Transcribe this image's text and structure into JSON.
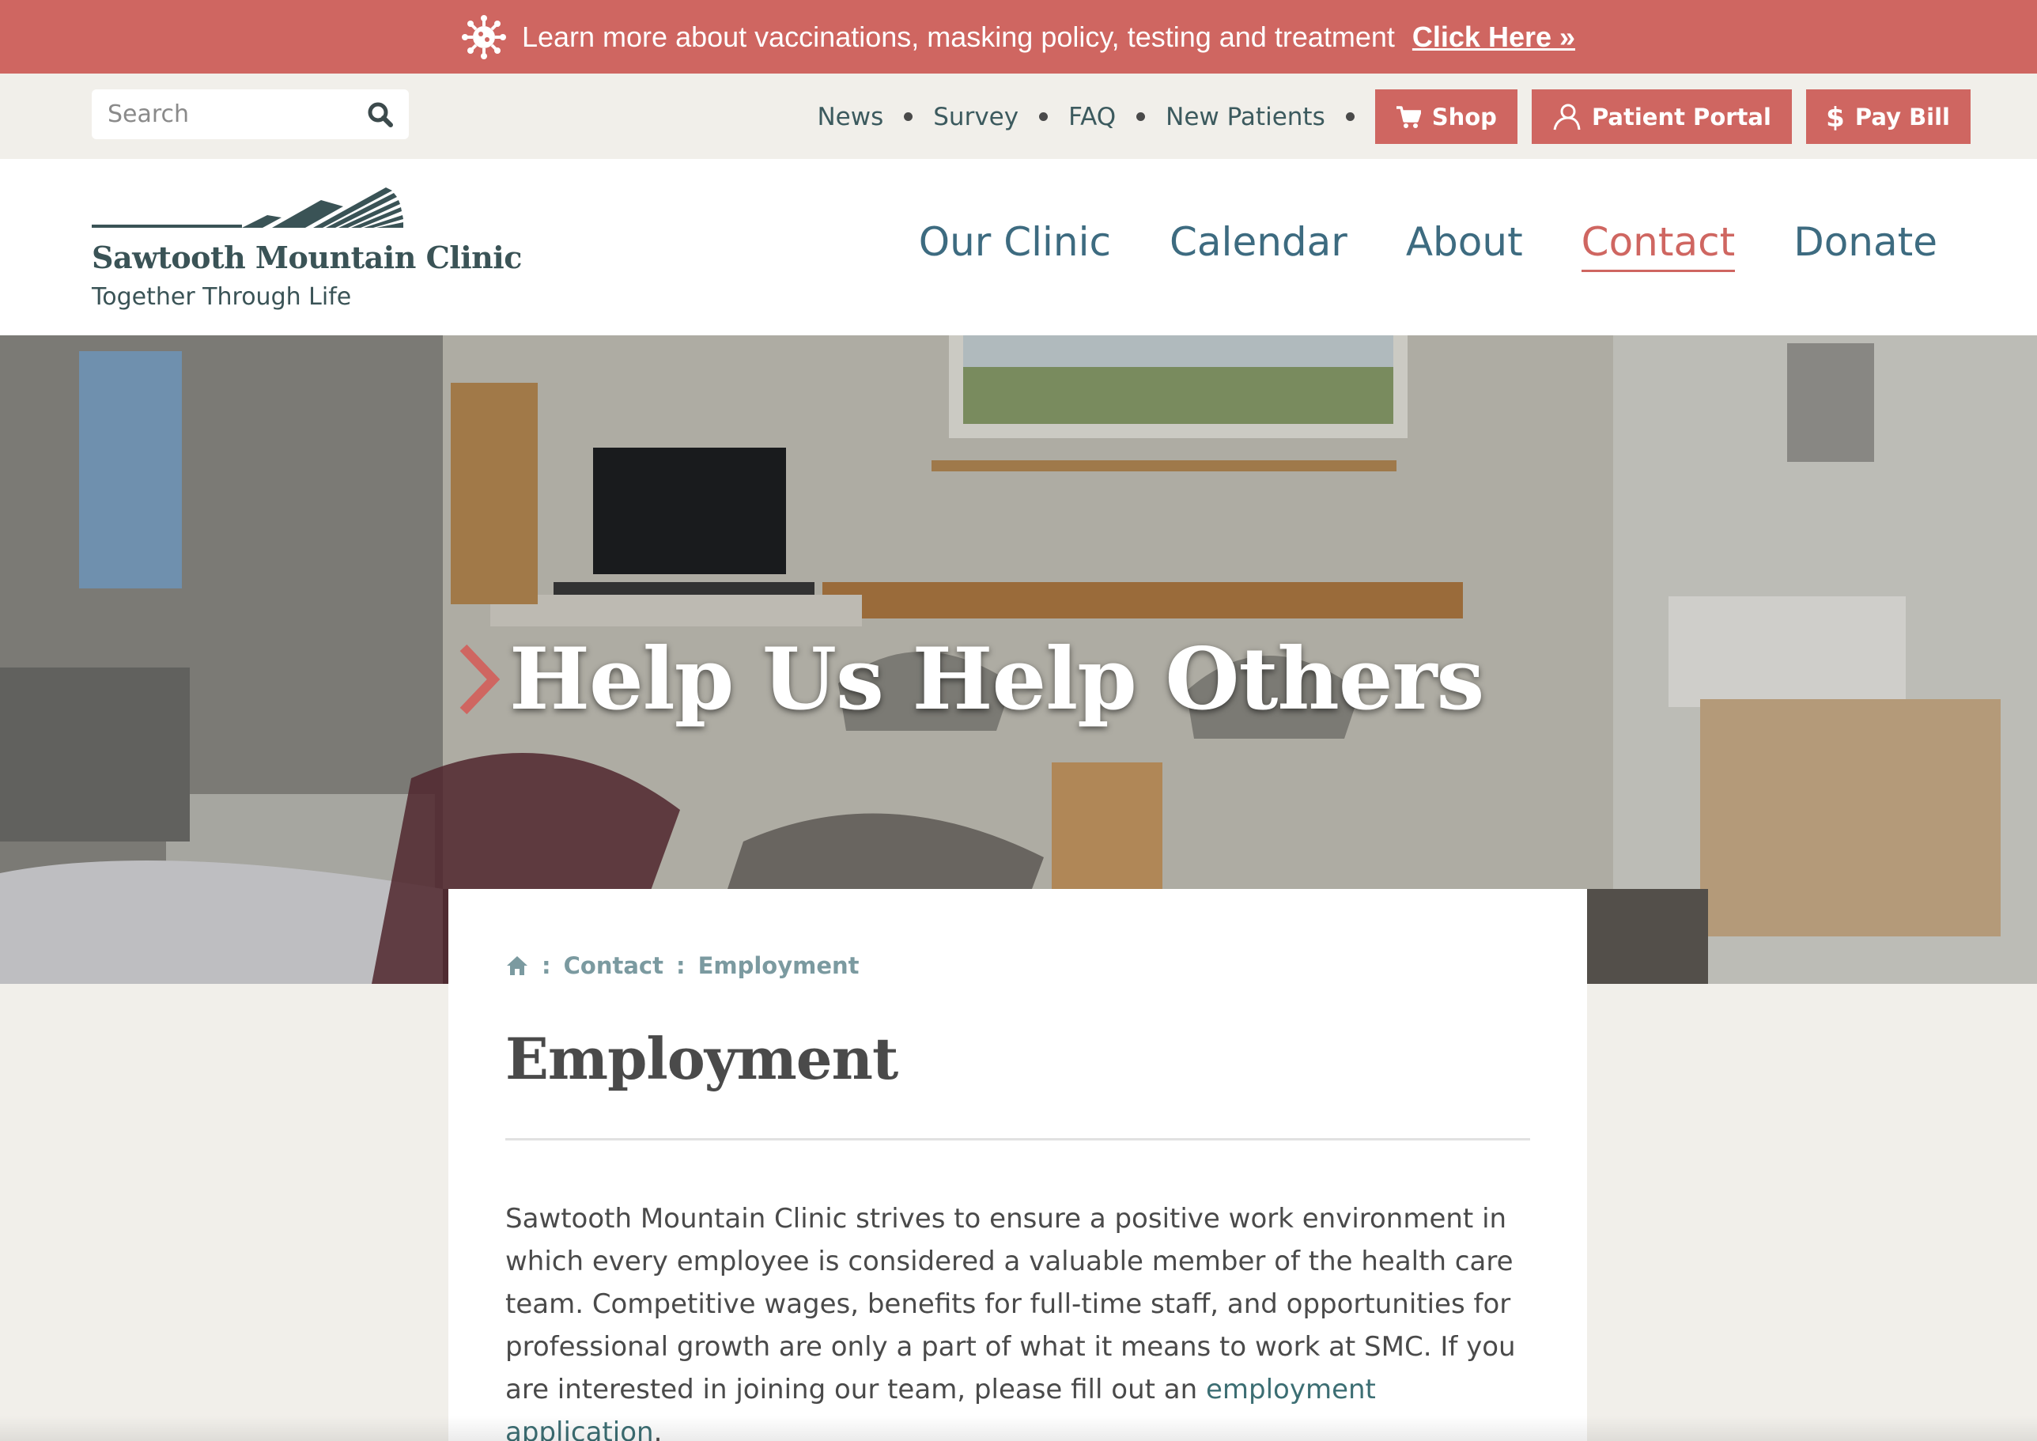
{
  "alert": {
    "text": "Learn more about vaccinations, masking policy, testing and treatment",
    "link": "Click Here »",
    "icon": "virus-icon"
  },
  "utility": {
    "search_placeholder": "Search",
    "links": [
      "News",
      "Survey",
      "FAQ",
      "New Patients"
    ],
    "buttons": {
      "shop": "Shop",
      "portal": "Patient Portal",
      "pay": "Pay Bill"
    }
  },
  "logo": {
    "name": "Sawtooth Mountain Clinic",
    "tagline": "Together Through Life"
  },
  "nav": {
    "items": [
      "Our Clinic",
      "Calendar",
      "About",
      "Contact",
      "Donate"
    ],
    "active": "Contact"
  },
  "hero": {
    "title": "Help Us Help Others"
  },
  "breadcrumb": {
    "items": [
      "Contact",
      "Employment"
    ],
    "separator": ":"
  },
  "content": {
    "title": "Employment",
    "paragraph": "Sawtooth Mountain Clinic strives to ensure a positive work environment in which every employee is considered a valuable member of the health care team. Competitive wages, benefits for full-time staff, and opportunities for professional growth are only a part of what it means to work at SMC. If you are interested in joining our team, please fill out an",
    "link": "employment application",
    "tail": "."
  },
  "colors": {
    "accent": "#cf6661",
    "nav": "#3d6b80",
    "logo": "#3a5356",
    "background": "#f1efea"
  }
}
